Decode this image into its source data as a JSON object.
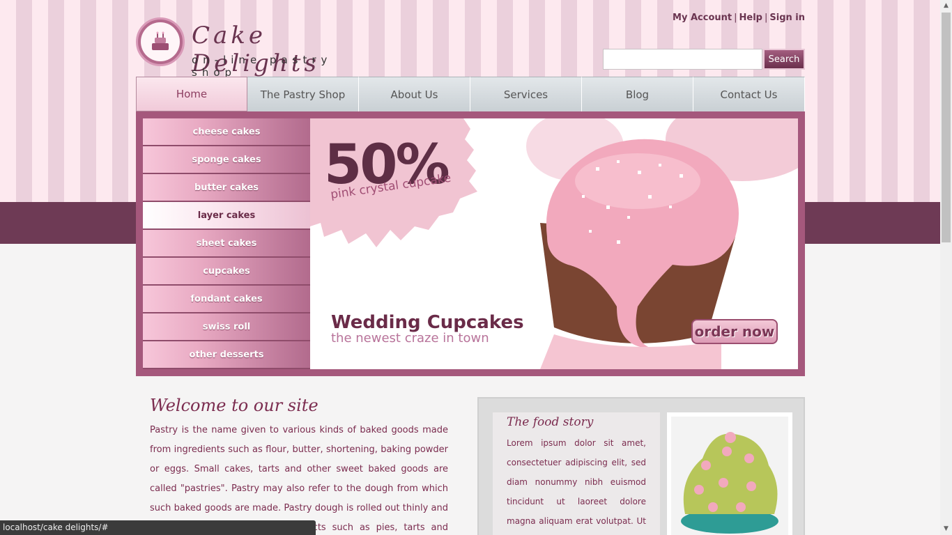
{
  "header": {
    "logo_title": "Cake Delights",
    "logo_subtitle": "on-line pastry shop",
    "links": [
      "My Account",
      "Help",
      "Sign in"
    ],
    "search_placeholder": "",
    "search_button": "Search"
  },
  "nav": {
    "items": [
      "Home",
      "The Pastry Shop",
      "About Us",
      "Services",
      "Blog",
      "Contact Us"
    ],
    "active": "Home"
  },
  "sidebar": {
    "items": [
      "cheese cakes",
      "sponge cakes",
      "butter cakes",
      "layer cakes",
      "sheet cakes",
      "cupcakes",
      "fondant cakes",
      "swiss roll",
      "other desserts"
    ],
    "active": "layer cakes"
  },
  "banner": {
    "percent": "50%",
    "percent_caption": "pink crystal cupcake",
    "title": "Wedding Cupcakes",
    "subtitle": "the newest craze in town",
    "order_button": "order now"
  },
  "welcome": {
    "title": "Welcome to our site",
    "text": "Pastry is the name given to various kinds of baked goods made from ingredients such as flour, butter, shortening, baking powder or eggs. Small cakes, tarts and other sweet baked goods are called \"pastries\". Pastry may also refer to the dough from which such baked goods are made. Pastry dough is rolled out thinly and used as a base for baked products such as pies, tarts and quiches."
  },
  "story": {
    "title": "The food story",
    "text": "Lorem ipsum dolor sit amet, consectetuer adipiscing elit, sed diam nonummy nibh euismod tincidunt ut laoreet dolore magna aliquam erat volutpat. Ut wisi"
  },
  "statusbar": {
    "url": "localhost/cake delights/#"
  },
  "colors": {
    "brand": "#6e3a55",
    "accent": "#a5587c",
    "pink": "#f3c8d7"
  }
}
